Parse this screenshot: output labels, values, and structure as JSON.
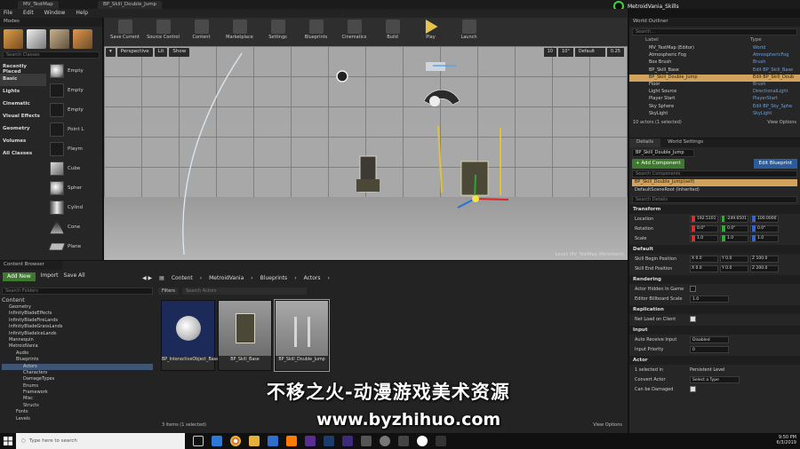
{
  "title_tabs": [
    "MV_TestMap",
    "BP_Skill_Double_Jump"
  ],
  "app_badge": "MetroidVania_Skills",
  "menu": [
    "File",
    "Edit",
    "Window",
    "Help"
  ],
  "modes": {
    "title": "Modes",
    "search_placeholder": "Search Classes",
    "categories": [
      "Recently Placed",
      "Basic",
      "Lights",
      "Cinematic",
      "Visual Effects",
      "Geometry",
      "Volumes",
      "All Classes"
    ],
    "items": [
      "Empty",
      "Empty",
      "Empty",
      "Point L",
      "Playm",
      "Cube",
      "Spher",
      "Cylind",
      "Cone",
      "Plane"
    ]
  },
  "toolbar": {
    "buttons": [
      "Save Current",
      "Source Control",
      "Content",
      "Marketplace",
      "Settings",
      "Blueprints",
      "Cinematics",
      "Build",
      "Play",
      "Launch"
    ]
  },
  "viewport": {
    "perspective": "Perspective",
    "lit": "Lit",
    "show": "Show",
    "snap_values": [
      "10",
      "10°",
      "0.25"
    ],
    "speed": "Default",
    "level_label": "Level: MV_TestMap (Persistent)"
  },
  "outliner": {
    "title": "World Outliner",
    "search_placeholder": "Search...",
    "col_label": "Label",
    "col_type": "Type",
    "rows": [
      {
        "label": "MV_TestMap (Editor)",
        "type": "World"
      },
      {
        "label": "Atmospheric Fog",
        "type": "AtmosphericFog"
      },
      {
        "label": "Box Brush",
        "type": "Brush"
      },
      {
        "label": "BP_Skill_Base",
        "type": "Edit BP_Skill_Base"
      },
      {
        "label": "BP_Skill_Double_Jump",
        "type": "Edit BP_Skill_Doub"
      },
      {
        "label": "Floor",
        "type": "Brush"
      },
      {
        "label": "Light Source",
        "type": "DirectionalLight"
      },
      {
        "label": "Player Start",
        "type": "PlayerStart"
      },
      {
        "label": "Sky Sphere",
        "type": "Edit BP_Sky_Sphe"
      },
      {
        "label": "SkyLight",
        "type": "SkyLight"
      }
    ],
    "count": "10 actors (1 selected)",
    "view_options": "View Options"
  },
  "details": {
    "tabs": [
      "Details",
      "World Settings"
    ],
    "object_name": "BP_Skill_Double_Jump",
    "add_component": "+ Add Component",
    "edit_blueprint": "Edit Blueprint",
    "search_components": "Search Components",
    "component_self": "BP_Skill_Double_Jump(self)",
    "root_component": "DefaultSceneRoot (Inherited)",
    "search_details": "Search Details",
    "transform": {
      "title": "Transform",
      "location_label": "Location",
      "location": [
        "192.5101",
        "-249.6501",
        "100.0000"
      ],
      "rotation_label": "Rotation",
      "rotation": [
        "0.0°",
        "0.0°",
        "0.0°"
      ],
      "scale_label": "Scale",
      "scale": [
        "1.0",
        "1.0",
        "1.0"
      ]
    },
    "default": {
      "title": "Default",
      "begin_label": "Skill Begin Position",
      "begin": [
        "X 0.0",
        "Y 0.0",
        "Z 100.0"
      ],
      "end_label": "Skill End Position",
      "end": [
        "X 0.0",
        "Y 0.0",
        "Z 200.0"
      ]
    },
    "rendering": {
      "title": "Rendering",
      "hidden_label": "Actor Hidden In Game",
      "billboard_label": "Editor Billboard Scale",
      "billboard": "1.0"
    },
    "replication": {
      "title": "Replication",
      "net_label": "Net Load on Client"
    },
    "input": {
      "title": "Input",
      "auto_label": "Auto Receive Input",
      "auto_value": "Disabled",
      "priority_label": "Input Priority",
      "priority_value": "0"
    },
    "actor": {
      "title": "Actor",
      "selected_label": "1 selected in",
      "selected_value": "Persistent Level",
      "convert_label": "Convert Actor",
      "convert_value": "Select a Type",
      "damaged_label": "Can be Damaged"
    }
  },
  "content_browser": {
    "tab": "Content Browser",
    "add_new": "Add New",
    "import": "Import",
    "save_all": "Save All",
    "path": [
      "Content",
      "MetroidVania",
      "Blueprints",
      "Actors"
    ],
    "search_folders": "Search Folders",
    "filters": "Filters",
    "search_assets": "Search Actors",
    "tree": [
      "Content",
      "Geometry",
      "InfinityBladeEffects",
      "InfinityBladeFireLands",
      "InfinityBladeGrassLands",
      "InfinityBladeIceLands",
      "Mannequin",
      "MetroidVania",
      "Audio",
      "Blueprints",
      "Actors",
      "Characters",
      "DamageTypes",
      "Enums",
      "Framework",
      "Misc",
      "Structs",
      "Fonts",
      "Levels"
    ],
    "assets": [
      "BP_InteractiveObject_Base",
      "BP_Skill_Base",
      "BP_Skill_Double_Jump"
    ],
    "status": "3 items (1 selected)",
    "view_options": "View Options"
  },
  "watermark": {
    "line1": "不移之火-动漫游戏美术资源",
    "line2": "www.byzhihuo.com"
  },
  "taskbar": {
    "search_placeholder": "Type here to search",
    "time": "9:50 PM",
    "date": "6/3/2019"
  },
  "colors": {
    "selection": "#d1a35c",
    "add_green": "#3d7a2e",
    "edit_blue": "#2b5c9c"
  }
}
